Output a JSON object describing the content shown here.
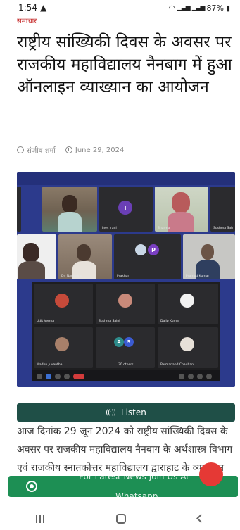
{
  "status": {
    "time": "1:54",
    "battery": "87%"
  },
  "article": {
    "category": "समाचार",
    "title": "राष्ट्रीय सांख्यिकी दिवस के अवसर पर राजकीय महाविद्यालय नैनबाग में हुआ ऑनलाइन व्याख्यान का आयोजन",
    "author": "संजीव शर्मा",
    "date": "June 29, 2024",
    "body": "आज दिनांक 29 जून 2024 को राष्ट्रीय सांख्यिकी दिवस के अवसर पर राजकीय महाविद्यालय नैनबाग के अर्थशास्त्र विभाग एवं राजकीय स्नातकोत्तर महाविद्यालय द्वाराहाट के व्याख्यान का आयोजन किया गया।"
  },
  "meeting": {
    "participants": [
      {
        "label": ""
      },
      {
        "label": ""
      },
      {
        "label": "I",
        "caption": "Ines Irani"
      },
      {
        "label": "",
        "caption": "Sharma"
      },
      {
        "label": "",
        "caption": "Sushma Sah"
      },
      {
        "label": "",
        "caption": ""
      },
      {
        "label": "",
        "caption": "Dr. Narendra"
      },
      {
        "label": "P",
        "caption": "Prakhar"
      },
      {
        "label": "",
        "caption": "Pramod Kumar"
      },
      {
        "label": "",
        "caption": "Udit Verma"
      },
      {
        "label": "",
        "caption": "Sushma Saini"
      },
      {
        "label": "",
        "caption": "Dalip Kumar"
      },
      {
        "label": "",
        "caption": "Madhu Juvantha"
      },
      {
        "label": "S",
        "caption": "30 others"
      },
      {
        "label": "",
        "caption": "Parmanand Chauhan"
      }
    ]
  },
  "listen": {
    "label": "Listen"
  },
  "whatsapp": {
    "line1": "For Latest News Join Us At",
    "line2": "Whatsapp"
  },
  "colors": {
    "category": "#c62828",
    "listen_bg": "#1f4f47",
    "whatsapp_bg": "#1d8f54",
    "meeting_bg": "#2c3a8c"
  }
}
